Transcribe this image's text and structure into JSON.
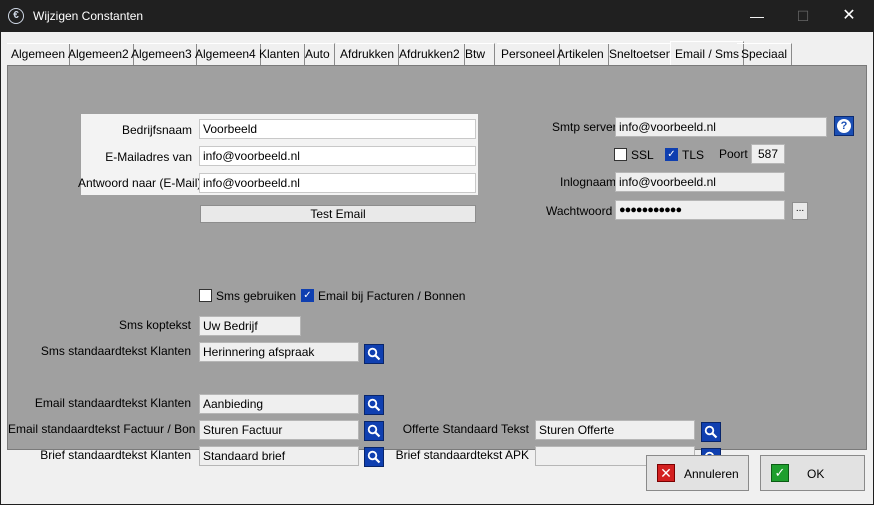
{
  "window": {
    "title": "Wijzigen Constanten",
    "minimize_glyph": "—",
    "maximize_glyph": "☐",
    "close_glyph": "✕"
  },
  "tabs": [
    {
      "label": "Algemeen"
    },
    {
      "label": "Algemeen2"
    },
    {
      "label": "Algemeen3"
    },
    {
      "label": "Algemeen4"
    },
    {
      "label": "Klanten"
    },
    {
      "label": "Auto"
    },
    {
      "label": "Afdrukken"
    },
    {
      "label": "Afdrukken2"
    },
    {
      "label": "Btw"
    },
    {
      "label": "Personeel"
    },
    {
      "label": "Artikelen"
    },
    {
      "label": "Sneltoetsen"
    },
    {
      "label": "Email / Sms"
    },
    {
      "label": "Speciaal"
    }
  ],
  "active_tab": "Email / Sms",
  "sender": {
    "company_label": "Bedrijfsnaam",
    "company_value": "Voorbeeld",
    "email_from_label": "E-Mailadres van",
    "email_from_value": "info@voorbeeld.nl",
    "reply_to_label": "Antwoord naar (E-Mail)",
    "reply_to_value": "info@voorbeeld.nl",
    "test_email_label": "Test Email"
  },
  "smtp": {
    "server_label": "Smtp server",
    "server_value": "info@voorbeeld.nl",
    "ssl_label": "SSL",
    "ssl_checked": false,
    "tls_label": "TLS",
    "tls_checked": true,
    "port_label": "Poort",
    "port_value": "587",
    "login_label": "Inlognaam",
    "login_value": "info@voorbeeld.nl",
    "password_label": "Wachtwoord",
    "password_value": "●●●●●●●●●●●",
    "dots_label": "...",
    "help_glyph": "?"
  },
  "options": {
    "sms_use_label": "Sms gebruiken",
    "sms_use_checked": false,
    "email_invoices_label": "Email bij Facturen / Bonnen",
    "email_invoices_checked": true
  },
  "sms": {
    "header_label": "Sms koptekst",
    "header_value": "Uw Bedrijf",
    "std_text_label": "Sms standaardtekst Klanten",
    "std_text_value": "Herinnering afspraak"
  },
  "email_texts": {
    "customers_label": "Email standaardtekst Klanten",
    "customers_value": "Aanbieding",
    "invoice_label": "Email standaardtekst Factuur / Bon",
    "invoice_value": "Sturen Factuur",
    "letter_label": "Brief standaardtekst Klanten",
    "letter_value": "Standaard brief",
    "quote_label": "Offerte Standaard Tekst",
    "quote_value": "Sturen Offerte",
    "letter_apk_label": "Brief standaardtekst APK",
    "letter_apk_value": ""
  },
  "footer": {
    "cancel_label": "Annuleren",
    "ok_label": "OK"
  },
  "colors": {
    "panel": "#a0a0a0",
    "accent_blue": "#0f3fb0",
    "cancel_red": "#d32020",
    "ok_green": "#1e9f2e"
  }
}
